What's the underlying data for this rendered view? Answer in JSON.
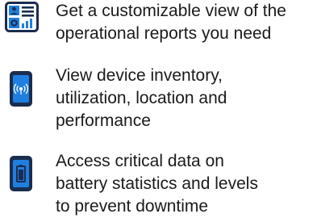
{
  "features": [
    {
      "icon": "reports-dashboard-icon",
      "lines": [
        "Get a customizable view of the",
        "operational reports you need"
      ]
    },
    {
      "icon": "device-signal-icon",
      "lines": [
        "View device inventory,",
        "utilization, location and",
        "performance"
      ]
    },
    {
      "icon": "device-battery-icon",
      "lines": [
        "Access critical data on",
        "battery statistics and levels",
        "to prevent downtime"
      ]
    }
  ],
  "colors": {
    "icon_blue": "#1f7fe0",
    "icon_dark": "#1b2d4f",
    "text": "#1a1a1a"
  }
}
